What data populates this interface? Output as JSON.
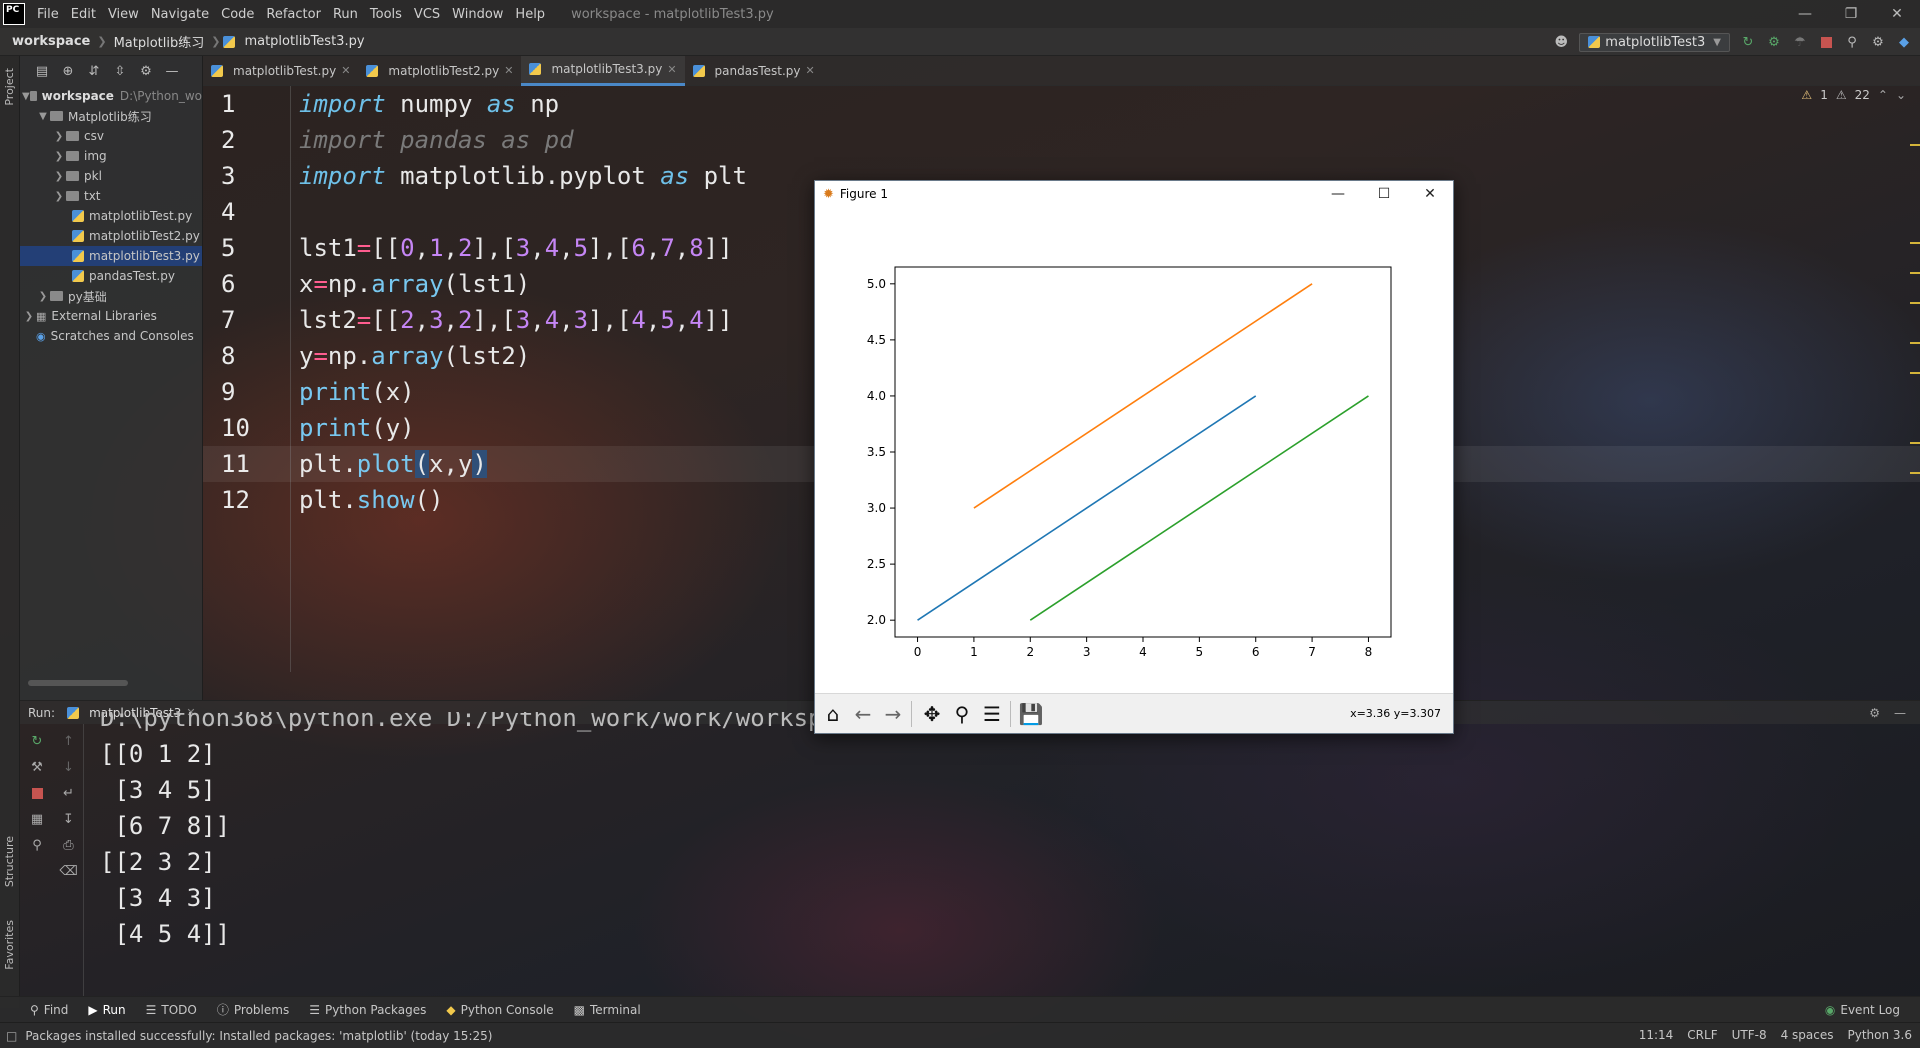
{
  "menubar": {
    "logo": "PC",
    "items": [
      "File",
      "Edit",
      "View",
      "Navigate",
      "Code",
      "Refactor",
      "Run",
      "Tools",
      "VCS",
      "Window",
      "Help"
    ],
    "window_title": "workspace - matplotlibTest3.py"
  },
  "navbar": {
    "crumbs": [
      "workspace",
      "Matplotlib练习",
      "matplotlibTest3.py"
    ],
    "run_config": "matplotlibTest3"
  },
  "left_stripe": {
    "project": "Project",
    "structure": "Structure",
    "favorites": "Favorites"
  },
  "project": {
    "root_label": "workspace",
    "root_path": "D:\\Python_wo",
    "items": [
      {
        "label": "Matplotlib练习",
        "kind": "folder",
        "level": 1,
        "expanded": true
      },
      {
        "label": "csv",
        "kind": "folder",
        "level": 2
      },
      {
        "label": "img",
        "kind": "folder",
        "level": 2
      },
      {
        "label": "pkl",
        "kind": "folder",
        "level": 2
      },
      {
        "label": "txt",
        "kind": "folder",
        "level": 2
      },
      {
        "label": "matplotlibTest.py",
        "kind": "py",
        "level": 2
      },
      {
        "label": "matplotlibTest2.py",
        "kind": "py",
        "level": 2
      },
      {
        "label": "matplotlibTest3.py",
        "kind": "py",
        "level": 2,
        "selected": true
      },
      {
        "label": "pandasTest.py",
        "kind": "py",
        "level": 2
      },
      {
        "label": "py基础",
        "kind": "folder",
        "level": 1
      },
      {
        "label": "External Libraries",
        "kind": "lib",
        "level": 0
      },
      {
        "label": "Scratches and Consoles",
        "kind": "scratch",
        "level": 0
      }
    ]
  },
  "tabs": [
    {
      "label": "matplotlibTest.py",
      "active": false
    },
    {
      "label": "matplotlibTest2.py",
      "active": false
    },
    {
      "label": "matplotlibTest3.py",
      "active": true
    },
    {
      "label": "pandasTest.py",
      "active": false
    }
  ],
  "inspections": {
    "warnings": "1",
    "weak_warnings": "22"
  },
  "code": {
    "line_numbers": [
      "1",
      "2",
      "3",
      "4",
      "5",
      "6",
      "7",
      "8",
      "9",
      "10",
      "11",
      "12"
    ],
    "l1": {
      "a": "import",
      "b": " numpy ",
      "c": "as",
      "d": " np"
    },
    "l2": "import pandas as pd",
    "l3": {
      "a": "import",
      "b": " matplotlib.pyplot ",
      "c": "as",
      "d": " plt"
    },
    "l5": {
      "a": "lst1",
      "b": "=",
      "c": "[[",
      "n1": "0",
      "s1": ",",
      "n2": "1",
      "s2": ",",
      "n3": "2",
      "c2": "],[",
      "n4": "3",
      "s3": ",",
      "n5": "4",
      "s4": ",",
      "n6": "5",
      "c3": "],[",
      "n7": "6",
      "s5": ",",
      "n8": "7",
      "s6": ",",
      "n9": "8",
      "c4": "]]"
    },
    "l6": {
      "a": "x",
      "b": "=",
      "c": "np.",
      "d": "array",
      "e": "(lst1)"
    },
    "l7": {
      "a": "lst2",
      "b": "=",
      "c": "[[",
      "n1": "2",
      "s1": ",",
      "n2": "3",
      "s2": ",",
      "n3": "2",
      "c2": "],[",
      "n4": "3",
      "s3": ",",
      "n5": "4",
      "s4": ",",
      "n6": "3",
      "c3": "],[",
      "n7": "4",
      "s5": ",",
      "n8": "5",
      "s6": ",",
      "n9": "4",
      "c4": "]]"
    },
    "l8": {
      "a": "y",
      "b": "=",
      "c": "np.",
      "d": "array",
      "e": "(lst2)"
    },
    "l9": {
      "a": "print",
      "b": "(x)"
    },
    "l10": {
      "a": "print",
      "b": "(y)"
    },
    "l11": {
      "a": "plt.",
      "b": "plot",
      "c": "(",
      "d": "x,y",
      "e": ")"
    },
    "l12": {
      "a": "plt.",
      "b": "show",
      "c": "()"
    }
  },
  "run": {
    "label": "Run:",
    "tab": "matplotlibTest3",
    "console": [
      "D:\\python368\\python.exe D:/Python_work/work/workspace/Matplotlib练习/matplotlibTest3.py",
      "[[0 1 2]",
      " [3 4 5]",
      " [6 7 8]]",
      "[[2 3 2]",
      " [3 4 3]",
      " [4 5 4]]"
    ]
  },
  "bottom_tabs": [
    "Find",
    "Run",
    "TODO",
    "Problems",
    "Python Packages",
    "Python Console",
    "Terminal"
  ],
  "event_log": "Event Log",
  "status": {
    "message": "Packages installed successfully: Installed packages: 'matplotlib' (today 15:25)",
    "position": "11:14",
    "line_sep": "CRLF",
    "encoding": "UTF-8",
    "indent": "4 spaces",
    "interpreter": "Python 3.6"
  },
  "figure": {
    "title": "Figure 1",
    "coords": "x=3.36 y=3.307"
  },
  "chart_data": {
    "type": "line",
    "title": "",
    "xlabel": "",
    "ylabel": "",
    "xlim": [
      -0.4,
      8.4
    ],
    "ylim": [
      1.85,
      5.15
    ],
    "xticks": [
      0,
      1,
      2,
      3,
      4,
      5,
      6,
      7,
      8
    ],
    "yticks": [
      2.0,
      2.5,
      3.0,
      3.5,
      4.0,
      4.5,
      5.0
    ],
    "ytick_labels": [
      "2.0",
      "2.5",
      "3.0",
      "3.5",
      "4.0",
      "4.5",
      "5.0"
    ],
    "grid": false,
    "series": [
      {
        "color": "#1f77b4",
        "x": [
          0,
          3,
          6
        ],
        "y": [
          2,
          3,
          4
        ]
      },
      {
        "color": "#ff7f0e",
        "x": [
          1,
          4,
          7
        ],
        "y": [
          3,
          4,
          5
        ]
      },
      {
        "color": "#2ca02c",
        "x": [
          2,
          5,
          8
        ],
        "y": [
          2,
          3,
          4
        ]
      }
    ]
  }
}
